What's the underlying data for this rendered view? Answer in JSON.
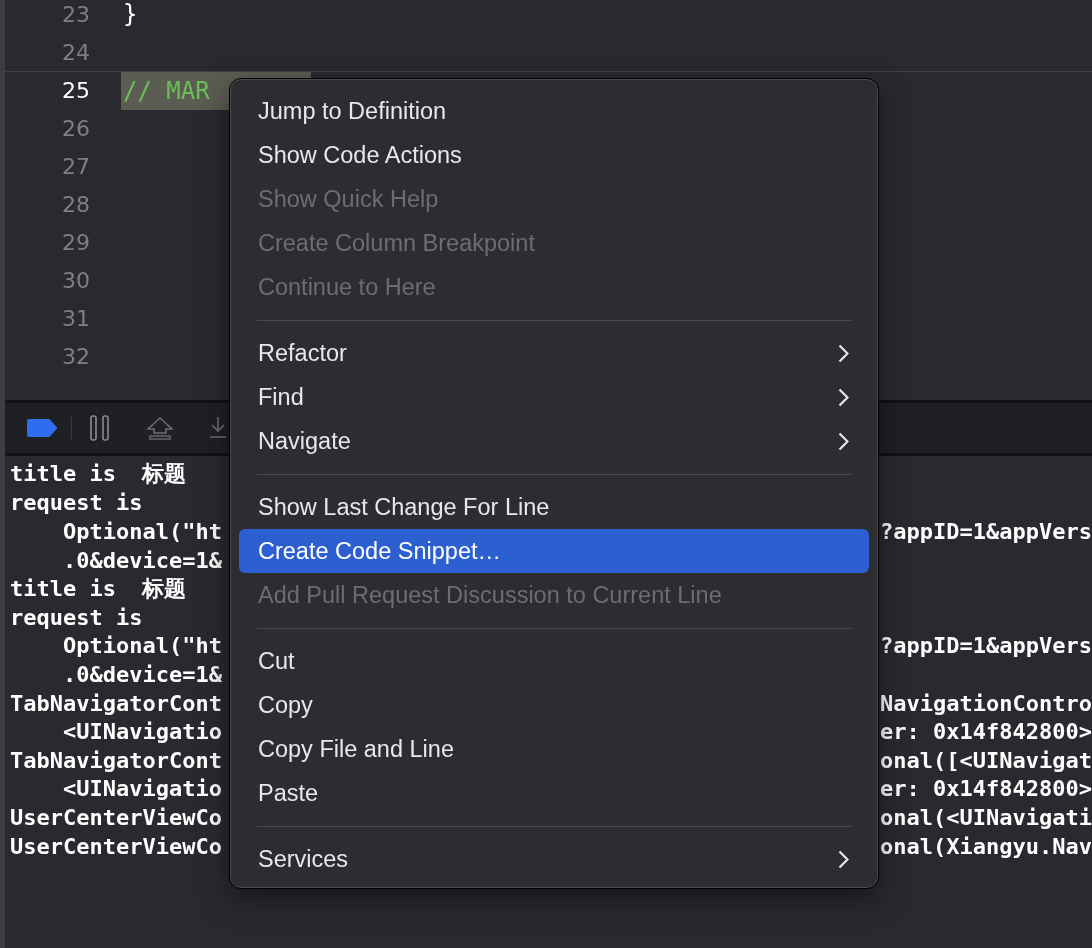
{
  "editor": {
    "lines": [
      {
        "number": "23",
        "code": "}",
        "kind": "plain",
        "current": false,
        "highlighted": false
      },
      {
        "number": "24",
        "current": false
      },
      {
        "number": "25",
        "code": "// MAR",
        "kind": "comment",
        "current": true,
        "highlighted": true
      },
      {
        "number": "26",
        "current": false
      },
      {
        "number": "27",
        "current": false
      },
      {
        "number": "28",
        "current": false
      },
      {
        "number": "29",
        "current": false
      },
      {
        "number": "30",
        "current": false
      },
      {
        "number": "31",
        "current": false
      },
      {
        "number": "32",
        "current": false
      }
    ]
  },
  "debug_bar": {
    "breakpoints_active": true
  },
  "console": {
    "lines": [
      {
        "left": "title is  标题"
      },
      {
        "left": "request is"
      },
      {
        "left": "    Optional(\"ht",
        "right": "?appID=1&appVers"
      },
      {
        "left": "    .0&device=1&"
      },
      {
        "left": "title is  标题"
      },
      {
        "left": "request is"
      },
      {
        "left": "    Optional(\"ht",
        "right": "?appID=1&appVers"
      },
      {
        "left": "    .0&device=1&"
      },
      {
        "left": "TabNavigatorCont",
        "right": "NavigationContro"
      },
      {
        "left": "    <UINavigatio",
        "right": "er: 0x14f842800>"
      },
      {
        "left": "TabNavigatorCont",
        "right": "onal([<UINavigat"
      },
      {
        "left": "    <UINavigatio",
        "right": "er: 0x14f842800>"
      },
      {
        "left": "UserCenterViewCo",
        "right": "onal(<UINavigati"
      },
      {
        "left": "UserCenterViewCo",
        "right": "onal(Xiangyu.Nav"
      }
    ]
  },
  "context_menu": {
    "items": [
      {
        "kind": "item",
        "label": "Jump to Definition",
        "disabled": false,
        "submenu": false,
        "selected": false
      },
      {
        "kind": "item",
        "label": "Show Code Actions",
        "disabled": false,
        "submenu": false,
        "selected": false
      },
      {
        "kind": "item",
        "label": "Show Quick Help",
        "disabled": true,
        "submenu": false,
        "selected": false
      },
      {
        "kind": "item",
        "label": "Create Column Breakpoint",
        "disabled": true,
        "submenu": false,
        "selected": false
      },
      {
        "kind": "item",
        "label": "Continue to Here",
        "disabled": true,
        "submenu": false,
        "selected": false
      },
      {
        "kind": "separator"
      },
      {
        "kind": "item",
        "label": "Refactor",
        "disabled": false,
        "submenu": true,
        "selected": false
      },
      {
        "kind": "item",
        "label": "Find",
        "disabled": false,
        "submenu": true,
        "selected": false
      },
      {
        "kind": "item",
        "label": "Navigate",
        "disabled": false,
        "submenu": true,
        "selected": false
      },
      {
        "kind": "separator"
      },
      {
        "kind": "item",
        "label": "Show Last Change For Line",
        "disabled": false,
        "submenu": false,
        "selected": false
      },
      {
        "kind": "item",
        "label": "Create Code Snippet…",
        "disabled": false,
        "submenu": false,
        "selected": true
      },
      {
        "kind": "item",
        "label": "Add Pull Request Discussion to Current Line",
        "disabled": true,
        "submenu": false,
        "selected": false
      },
      {
        "kind": "separator"
      },
      {
        "kind": "item",
        "label": "Cut",
        "disabled": false,
        "submenu": false,
        "selected": false
      },
      {
        "kind": "item",
        "label": "Copy",
        "disabled": false,
        "submenu": false,
        "selected": false
      },
      {
        "kind": "item",
        "label": "Copy File and Line",
        "disabled": false,
        "submenu": false,
        "selected": false
      },
      {
        "kind": "item",
        "label": "Paste",
        "disabled": false,
        "submenu": false,
        "selected": false
      },
      {
        "kind": "separator"
      },
      {
        "kind": "item",
        "label": "Services",
        "disabled": false,
        "submenu": true,
        "selected": false
      }
    ]
  }
}
